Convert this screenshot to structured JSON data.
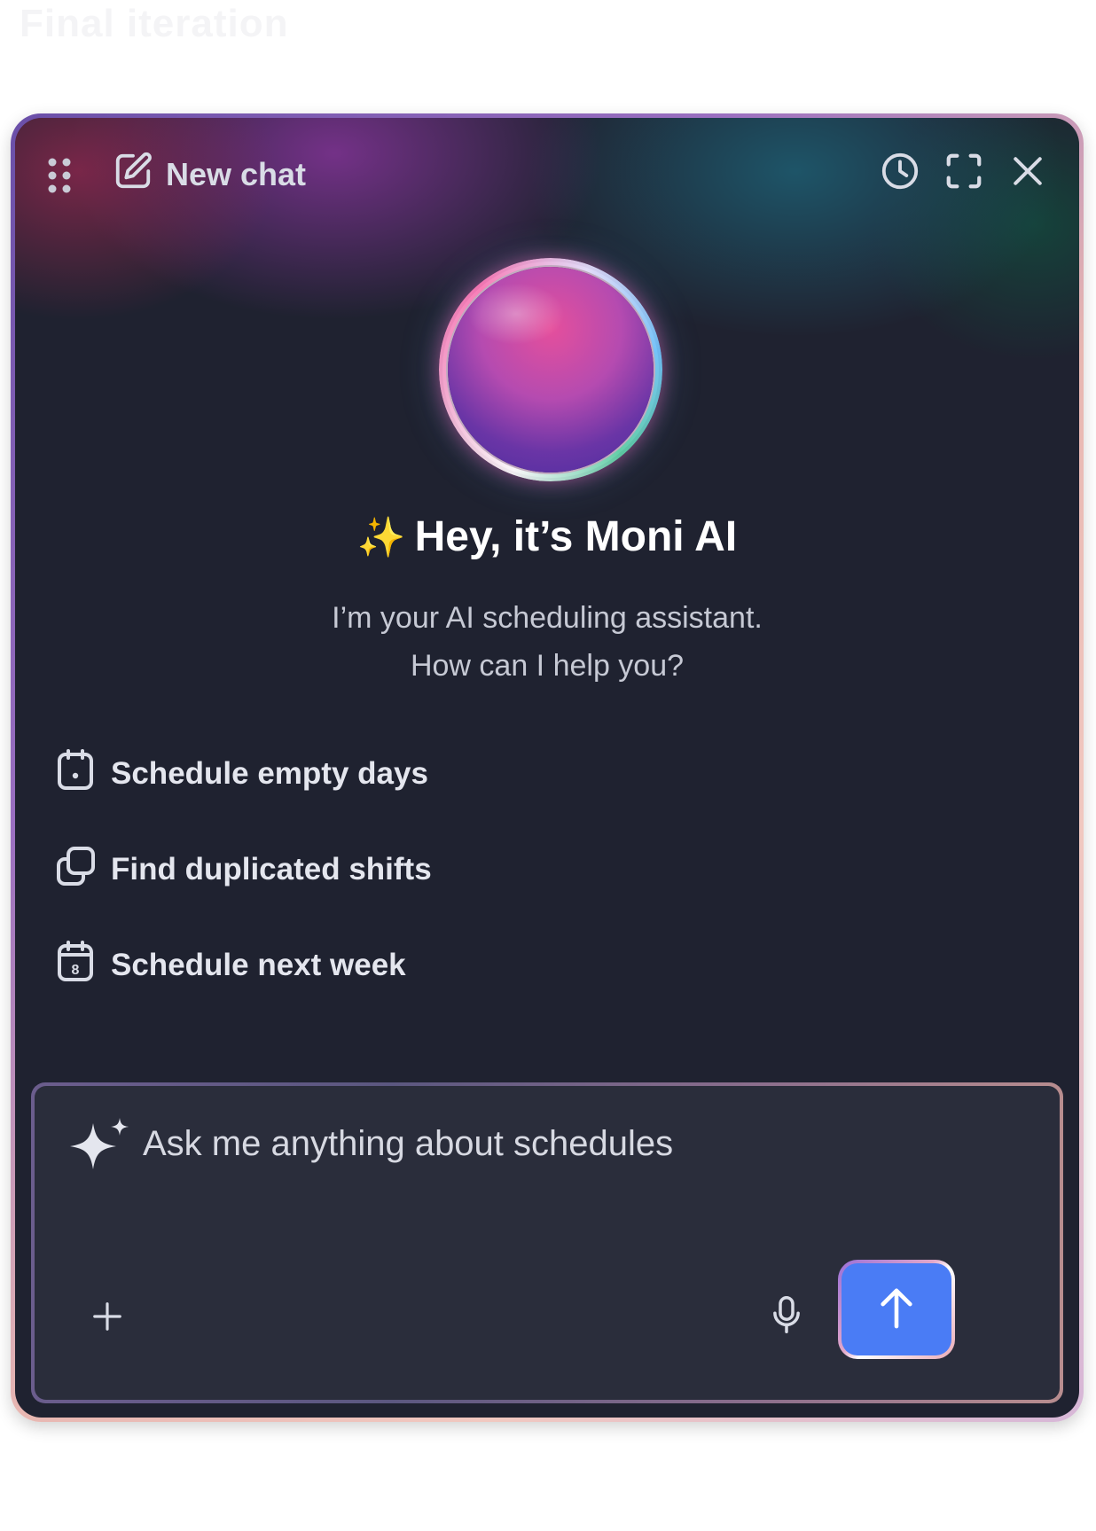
{
  "page": {
    "caption": "Final iteration"
  },
  "header": {
    "new_chat_label": "New chat",
    "actions": [
      {
        "icon": "clock-icon",
        "label": "History"
      },
      {
        "icon": "expand-icon",
        "label": "Expand"
      },
      {
        "icon": "close-icon",
        "label": "Close"
      }
    ]
  },
  "hero": {
    "sparkle": "✨",
    "title": "Hey, it’s Moni AI",
    "subtitle_line1": "I’m your AI scheduling assistant.",
    "subtitle_line2": "How can I help you?"
  },
  "suggestions": [
    {
      "icon": "calendar-dot-icon",
      "label": "Schedule empty days"
    },
    {
      "icon": "duplicate-icon",
      "label": "Find duplicated shifts"
    },
    {
      "icon": "calendar-8-icon",
      "label": "Schedule next week",
      "icon_text": "8"
    }
  ],
  "composer": {
    "placeholder": "Ask me anything about schedules",
    "value": ""
  },
  "colors": {
    "panel_bg": "#1f2230",
    "composer_bg": "#2a2d3b",
    "send_button": "#4a7cf5",
    "text_primary": "#ffffff",
    "text_secondary": "#c6c9d4",
    "sparkle": "#f5c542"
  }
}
